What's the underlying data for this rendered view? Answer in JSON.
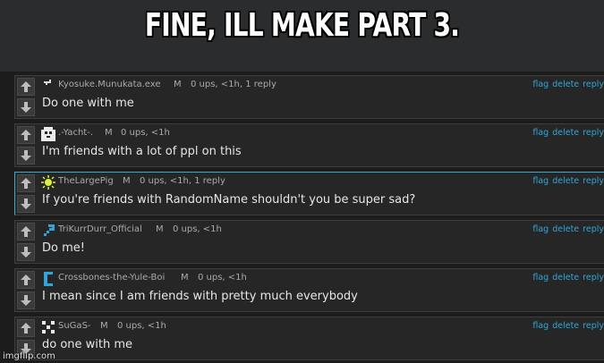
{
  "meme": {
    "caption": "FINE, ILL MAKE PART 3."
  },
  "watermark": "imgflip.com",
  "comments": [
    {
      "avatar": "pixel-arrow-icon",
      "username": "Kyosuke.Munukata.exe",
      "mod_badge": "M",
      "stats": "0 ups, <1h, 1 reply",
      "body": "Do one with me",
      "actions": [
        "flag",
        "delete",
        "reply"
      ]
    },
    {
      "avatar": "pixel-cat-icon",
      "username": ".-Yacht-.",
      "mod_badge": "M",
      "stats": "0 ups, <1h",
      "body": "I'm friends with a lot of ppl on this",
      "actions": [
        "flag",
        "delete",
        "reply"
      ]
    },
    {
      "avatar": "sun-icon",
      "username": "TheLargePig",
      "mod_badge": "M",
      "stats": "0 ups, <1h, 1 reply",
      "body": "If you're friends with RandomName shouldn't you be super sad?",
      "actions": [
        "flag",
        "delete",
        "reply"
      ]
    },
    {
      "avatar": "blue-arrow-icon",
      "username": "TriKurrDurr_Official",
      "mod_badge": "M",
      "stats": "0 ups, <1h",
      "body": "Do me!",
      "actions": [
        "flag",
        "delete",
        "reply"
      ]
    },
    {
      "avatar": "blue-c-icon",
      "username": "Crossbones-the-Yule-Boi",
      "mod_badge": "M",
      "stats": "0 ups, <1h",
      "body": "I mean since I am friends with pretty much everybody",
      "actions": [
        "flag",
        "delete",
        "reply"
      ]
    },
    {
      "avatar": "pixel-x-icon",
      "username": "SuGaS-",
      "mod_badge": "M",
      "stats": "0 ups, <1h",
      "body": "do one with me",
      "actions": [
        "flag",
        "delete",
        "reply"
      ]
    }
  ],
  "colors": {
    "link": "#2ea7d8",
    "highlight": "#3fa9c9",
    "background": "#1c1c1d"
  }
}
